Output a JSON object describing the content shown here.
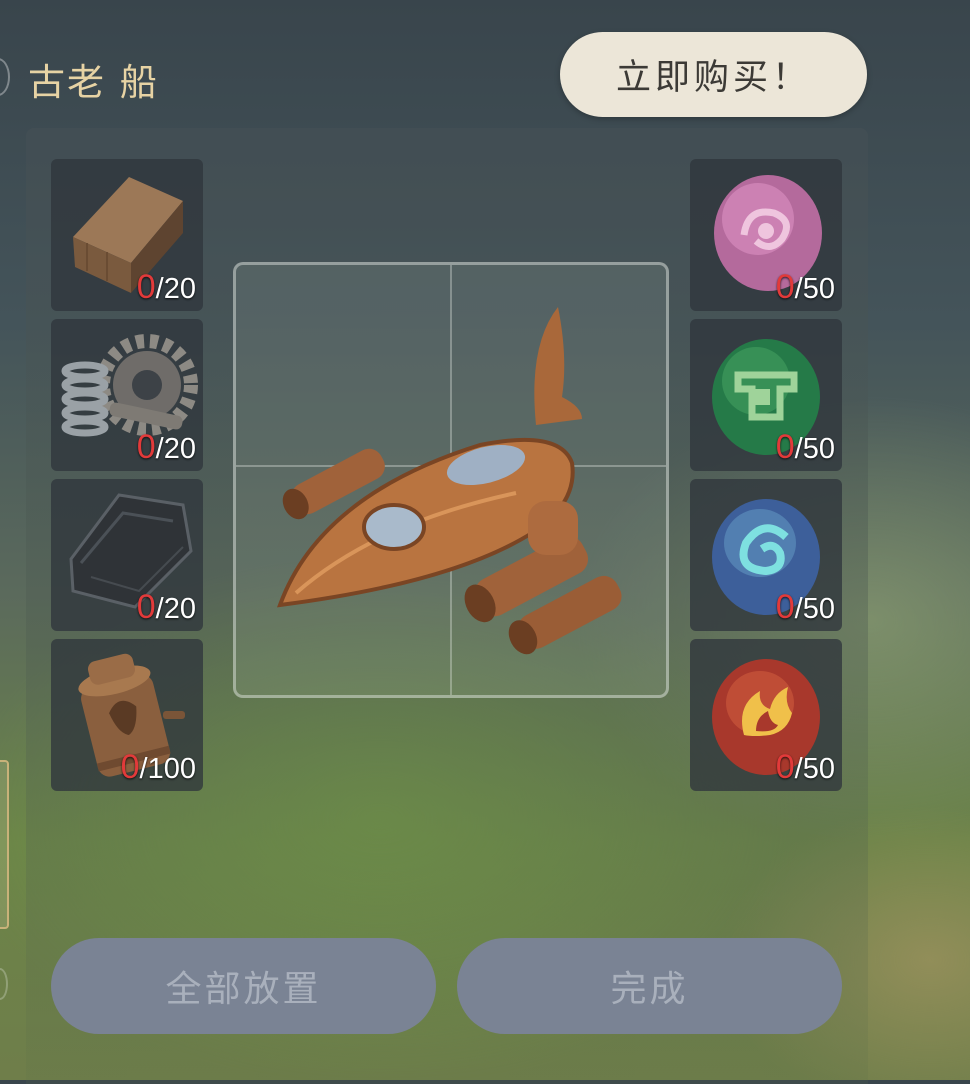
{
  "header": {
    "title": "古老 船",
    "buy_button_label": "立即购买！"
  },
  "materials_left": [
    {
      "icon": "wood-block-icon",
      "have": "0",
      "need": "/20"
    },
    {
      "icon": "gear-spring-icon",
      "have": "0",
      "need": "/20"
    },
    {
      "icon": "leather-cloth-icon",
      "have": "0",
      "need": "/20"
    },
    {
      "icon": "copper-canister-icon",
      "have": "0",
      "need": "/100"
    }
  ],
  "materials_right": [
    {
      "icon": "purple-essence-stone-icon",
      "have": "0",
      "need": "/50"
    },
    {
      "icon": "green-essence-stone-icon",
      "have": "0",
      "need": "/50"
    },
    {
      "icon": "blue-essence-stone-icon",
      "have": "0",
      "need": "/50"
    },
    {
      "icon": "red-essence-stone-icon",
      "have": "0",
      "need": "/50"
    }
  ],
  "preview": {
    "icon": "ancient-ship-icon"
  },
  "actions": {
    "place_all_label": "全部放置",
    "complete_label": "完成"
  },
  "colors": {
    "title": "#e7d3a4",
    "buy_button_bg": "#ece6d8",
    "count_missing": "#e23a3a",
    "action_button_bg": "#7a8394",
    "action_button_text": "#a9b0bc"
  }
}
